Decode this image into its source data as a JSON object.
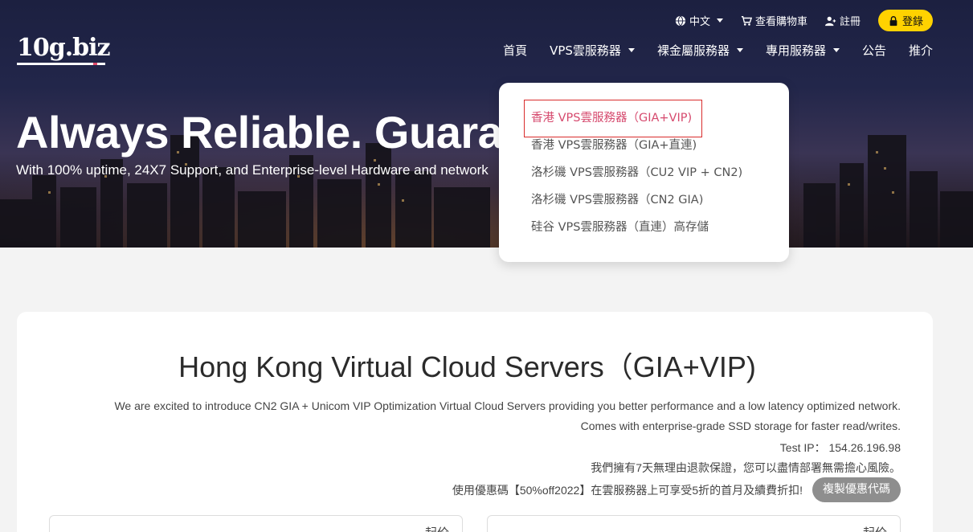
{
  "logo": {
    "text": "10g.biz"
  },
  "topbar": {
    "language": "中文",
    "cart": "查看購物車",
    "register": "註冊",
    "login": "登錄"
  },
  "nav": {
    "home": "首頁",
    "vps": "VPS雲服務器",
    "bare_metal": "裸金屬服務器",
    "dedicated": "專用服務器",
    "announcements": "公告",
    "referral": "推介"
  },
  "hero": {
    "title": "Always Reliable. Guaranteed.",
    "subtitle": "With 100% uptime, 24X7 Support, and Enterprise-level Hardware and network"
  },
  "dropdown": {
    "items": [
      "香港 VPS雲服務器（GIA+VIP)",
      "香港 VPS雲服務器（GIA+直連)",
      "洛杉磯 VPS雲服務器（CU2 VIP + CN2)",
      "洛杉磯 VPS雲服務器（CN2 GIA)",
      "硅谷 VPS雲服務器（直連）高存儲"
    ]
  },
  "content": {
    "title": "Hong Kong Virtual Cloud Servers（GIA+VIP)",
    "line1": "We are excited to introduce CN2 GIA + Unicom VIP Optimization Virtual Cloud Servers providing you better performance and a low latency optimized network.",
    "line2": "Comes with enterprise-grade SSD storage for faster read/writes.",
    "line3": "Test IP： 154.26.196.98",
    "line4": "我們擁有7天無理由退款保證，您可以盡情部署無需擔心風險。",
    "line5": "使用優惠碼【50%off2022】在雲服務器上可享受5折的首月及續費折扣!",
    "copy_button": "複製優惠代碼",
    "plan_label_1": "起价",
    "plan_label_2": "起价"
  },
  "colors": {
    "accent_yellow": "#ffd200",
    "active_link": "#d64a6e",
    "highlight_border": "#d92c2c"
  }
}
